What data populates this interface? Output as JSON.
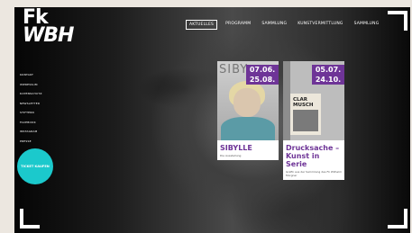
{
  "logo": {
    "line1": "Fk",
    "line2": "WBH"
  },
  "topnav": {
    "items": [
      {
        "label": "AKTUELLES",
        "active": true
      },
      {
        "label": "PROGRAMM",
        "active": false
      },
      {
        "label": "SAMMLUNG",
        "active": false
      },
      {
        "label": "KUNSTVERMITTLUNG",
        "active": false
      },
      {
        "label": "SAMMLUNG",
        "active": false
      }
    ]
  },
  "sidenav": {
    "items": [
      "KONTAKT",
      "IMPRESSUM",
      "DATENSCHUTZ",
      "NEWSLETTER",
      "STIFTERN",
      "FACEBOOK",
      "INSTAGRAM",
      "PRESSE"
    ]
  },
  "ticket_button": {
    "label": "TICKET KAUFEN"
  },
  "cards": [
    {
      "date_start": "07.06.",
      "date_end": "25.08.",
      "image_word": "SIBY",
      "title": "SIBYLLE",
      "subtitle": "Die Ausstellung"
    },
    {
      "date_start": "05.07.",
      "date_end": "24.10.",
      "image_word": "CLAR\nMUSCH",
      "title": "Drucksache – Kunst in Serie",
      "subtitle": "Grafik aus der Sammlung des Fk Wilhelm Morgner"
    }
  ],
  "colors": {
    "accent": "#6e3497",
    "ticket": "#1bc9cc",
    "background": "#0d0d0d"
  }
}
